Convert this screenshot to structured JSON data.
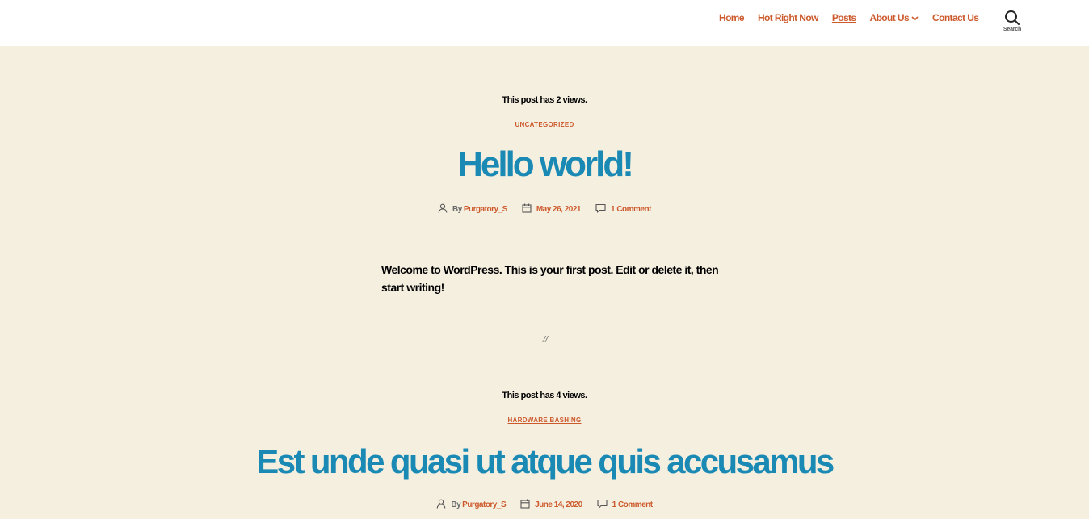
{
  "nav": {
    "items": [
      {
        "label": "Home"
      },
      {
        "label": "Hot Right Now"
      },
      {
        "label": "Posts"
      },
      {
        "label": "About Us"
      },
      {
        "label": "Contact Us"
      }
    ],
    "active": "Posts",
    "search_label": "Search"
  },
  "posts": [
    {
      "views": "This post has 2 views.",
      "category": "UNCATEGORIZED",
      "title": "Hello world!",
      "by": "By",
      "author": "Purgatory_S",
      "date": "May 26, 2021",
      "comments": "1 Comment",
      "excerpt": "Welcome to WordPress. This is your first post. Edit or delete it, then start writing!"
    },
    {
      "views": "This post has 4 views.",
      "category": "HARDWARE BASHING",
      "title": "Est unde quasi ut atque quis accusamus",
      "by": "By",
      "author": "Purgatory_S",
      "date": "June 14, 2020",
      "comments": "1 Comment"
    }
  ],
  "separator_mark": "//",
  "colors": {
    "background": "#f5efe0",
    "accent": "#cd5a2d",
    "title": "#1a8ab5",
    "header": "#ffffff"
  }
}
